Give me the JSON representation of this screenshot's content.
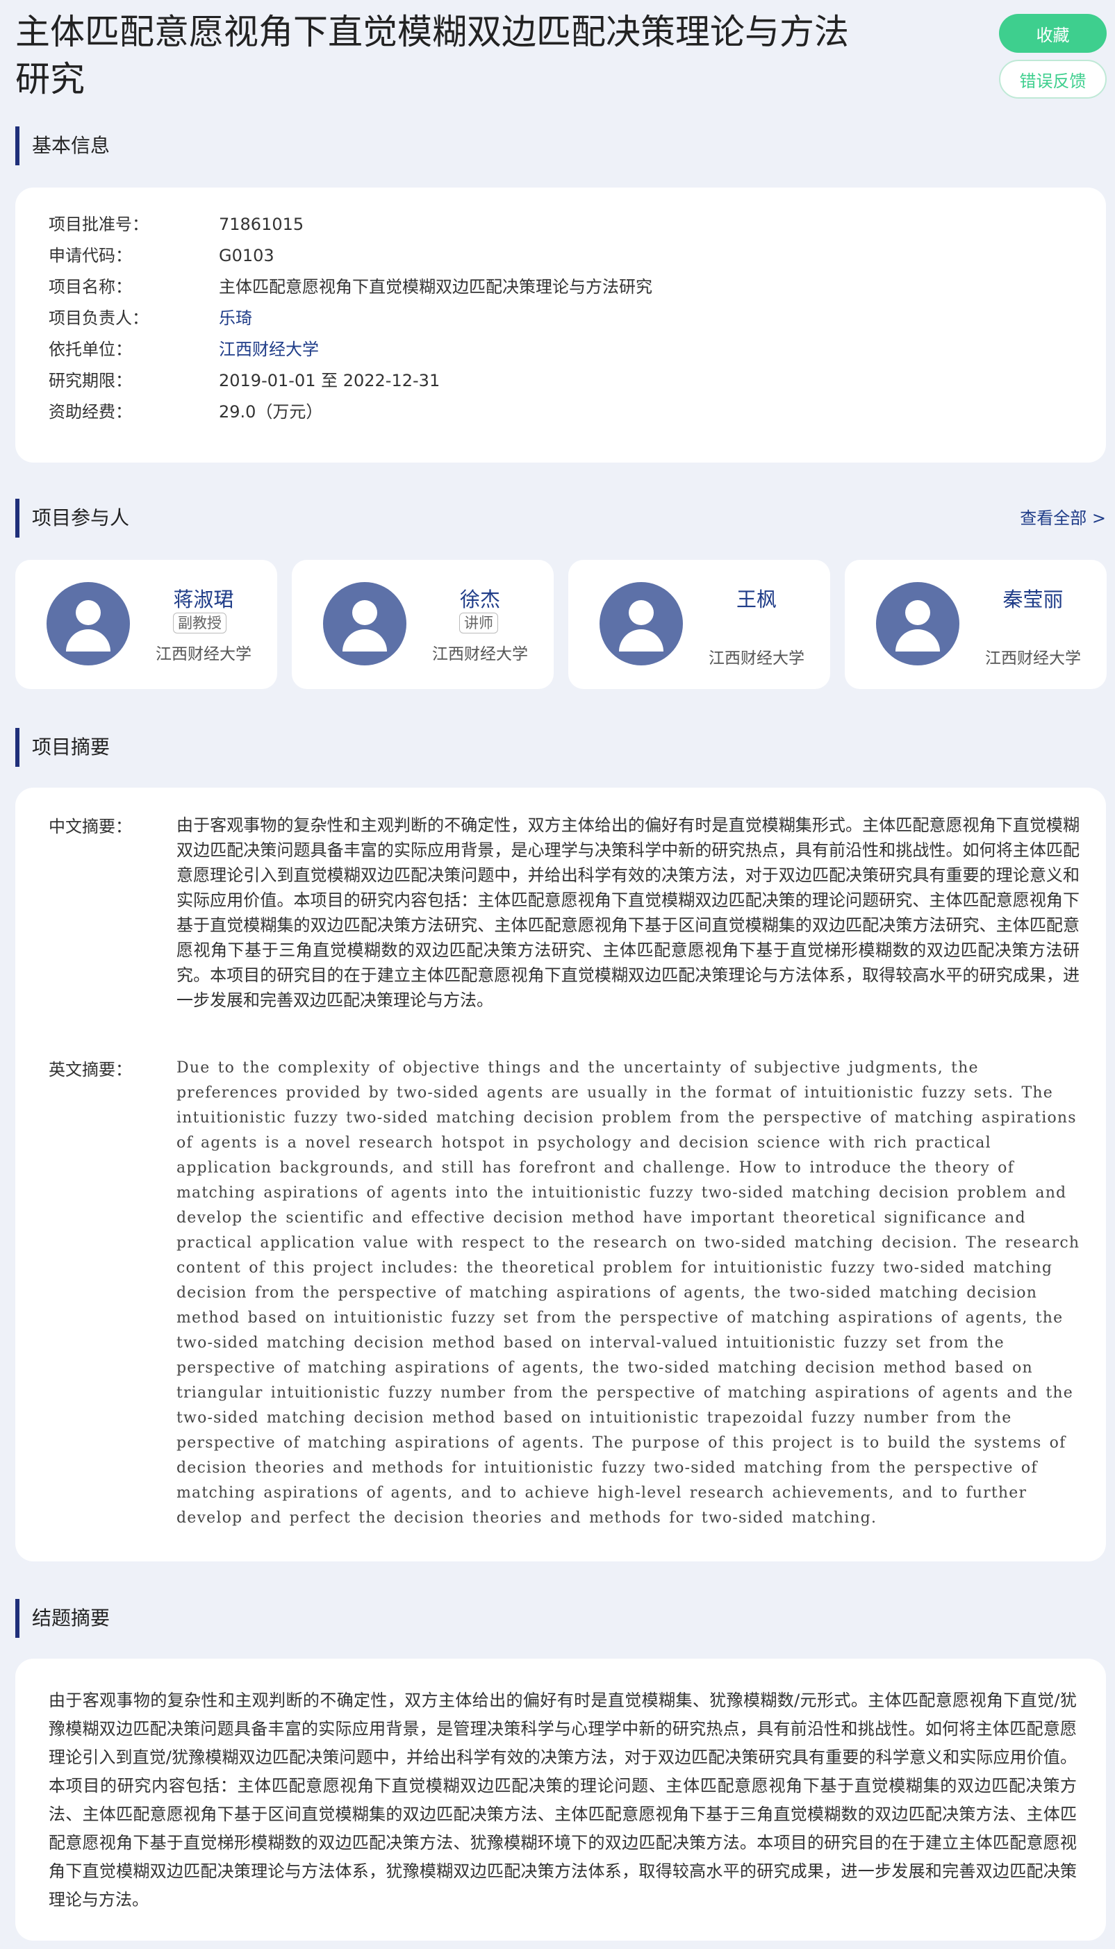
{
  "header": {
    "title": "主体匹配意愿视角下直觉模糊双边匹配决策理论与方法研究",
    "collect_label": "收藏",
    "feedback_label": "错误反馈"
  },
  "basic_info": {
    "section_title": "基本信息",
    "rows": [
      {
        "label": "项目批准号：",
        "value": "71861015"
      },
      {
        "label": "申请代码：",
        "value": "G0103"
      },
      {
        "label": "项目名称：",
        "value": "主体匹配意愿视角下直觉模糊双边匹配决策理论与方法研究"
      },
      {
        "label": "项目负责人：",
        "value": "乐琦"
      },
      {
        "label": "依托单位：",
        "value": "江西财经大学"
      },
      {
        "label": "研究期限：",
        "value": "2019-01-01 至 2022-12-31"
      },
      {
        "label": "资助经费：",
        "value": "29.0（万元）"
      }
    ]
  },
  "participants": {
    "section_title": "项目参与人",
    "view_all": "查看全部 >",
    "people": [
      {
        "name": "蒋淑珺",
        "title": "副教授",
        "org": "江西财经大学"
      },
      {
        "name": "徐杰",
        "title": "讲师",
        "org": "江西财经大学"
      },
      {
        "name": "王枫",
        "title": "",
        "org": "江西财经大学"
      },
      {
        "name": "秦莹丽",
        "title": "",
        "org": "江西财经大学"
      }
    ]
  },
  "abstract": {
    "section_title": "项目摘要",
    "cn_label": "中文摘要：",
    "cn_text": "由于客观事物的复杂性和主观判断的不确定性，双方主体给出的偏好有时是直觉模糊集形式。主体匹配意愿视角下直觉模糊双边匹配决策问题具备丰富的实际应用背景，是心理学与决策科学中新的研究热点，具有前沿性和挑战性。如何将主体匹配意愿理论引入到直觉模糊双边匹配决策问题中，并给出科学有效的决策方法，对于双边匹配决策研究具有重要的理论意义和实际应用价值。本项目的研究内容包括：主体匹配意愿视角下直觉模糊双边匹配决策的理论问题研究、主体匹配意愿视角下基于直觉模糊集的双边匹配决策方法研究、主体匹配意愿视角下基于区间直觉模糊集的双边匹配决策方法研究、主体匹配意愿视角下基于三角直觉模糊数的双边匹配决策方法研究、主体匹配意愿视角下基于直觉梯形模糊数的双边匹配决策方法研究。本项目的研究目的在于建立主体匹配意愿视角下直觉模糊双边匹配决策理论与方法体系，取得较高水平的研究成果，进一步发展和完善双边匹配决策理论与方法。",
    "en_label": "英文摘要：",
    "en_text": "Due to the complexity of objective things and the uncertainty of subjective judgments, the preferences provided by two-sided agents are usually in the format of intuitionistic fuzzy sets. The intuitionistic fuzzy two-sided matching decision problem from the perspective of matching aspirations of agents is a novel research hotspot in psychology and decision science with rich practical application backgrounds, and still has forefront and challenge. How to introduce the theory of matching aspirations of agents into the intuitionistic fuzzy two-sided matching decision problem and develop the scientific and effective decision method have important theoretical significance and practical application value with respect to the research on two-sided matching decision. The research content of this project includes: the theoretical problem for intuitionistic fuzzy two-sided matching decision from the perspective of matching aspirations of agents, the two-sided matching decision method based on intuitionistic fuzzy set from the perspective of matching aspirations of agents, the two-sided matching decision method based on interval-valued intuitionistic fuzzy set from the perspective of matching aspirations of agents, the two-sided matching decision method based on triangular intuitionistic fuzzy number from the perspective of matching aspirations of agents and the two-sided matching decision method based on intuitionistic trapezoidal fuzzy number from the perspective of matching aspirations of agents. The purpose of this project is to build the systems of decision theories and methods for intuitionistic fuzzy two-sided matching from the perspective of matching aspirations of agents, and to achieve high-level research achievements, and to further develop and perfect the decision theories and methods for two-sided matching."
  },
  "final_summary": {
    "section_title": "结题摘要",
    "text": "由于客观事物的复杂性和主观判断的不确定性，双方主体给出的偏好有时是直觉模糊集、犹豫模糊数/元形式。主体匹配意愿视角下直觉/犹豫模糊双边匹配决策问题具备丰富的实际应用背景，是管理决策科学与心理学中新的研究热点，具有前沿性和挑战性。如何将主体匹配意愿理论引入到直觉/犹豫模糊双边匹配决策问题中，并给出科学有效的决策方法，对于双边匹配决策研究具有重要的科学意义和实际应用价值。本项目的研究内容包括：主体匹配意愿视角下直觉模糊双边匹配决策的理论问题、主体匹配意愿视角下基于直觉模糊集的双边匹配决策方法、主体匹配意愿视角下基于区间直觉模糊集的双边匹配决策方法、主体匹配意愿视角下基于三角直觉模糊数的双边匹配决策方法、主体匹配意愿视角下基于直觉梯形模糊数的双边匹配决策方法、犹豫模糊环境下的双边匹配决策方法。本项目的研究目的在于建立主体匹配意愿视角下直觉模糊双边匹配决策理论与方法体系，犹豫模糊双边匹配决策方法体系，取得较高水平的研究成果，进一步发展和完善双边匹配决策理论与方法。"
  },
  "colors": {
    "accent_green": "#3ecf8e",
    "link_blue": "#1f3c88",
    "section_bar": "#1f2f7a",
    "avatar_bg": "#5d71a8",
    "page_bg": "#eef1f8"
  }
}
